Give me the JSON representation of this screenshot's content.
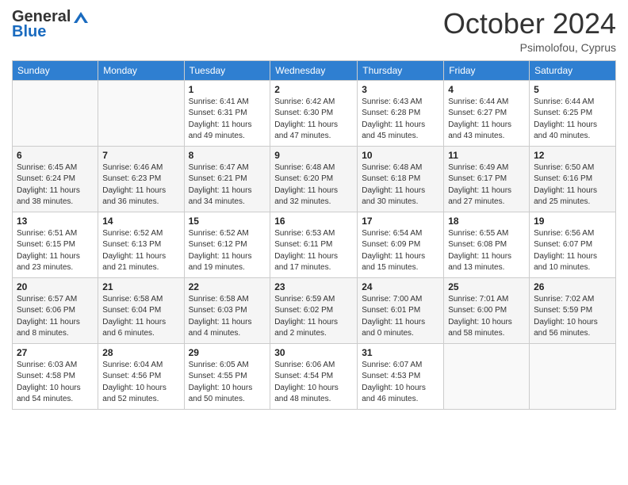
{
  "logo": {
    "general": "General",
    "blue": "Blue"
  },
  "header": {
    "month": "October 2024",
    "location": "Psimolofou, Cyprus"
  },
  "days_of_week": [
    "Sunday",
    "Monday",
    "Tuesday",
    "Wednesday",
    "Thursday",
    "Friday",
    "Saturday"
  ],
  "weeks": [
    [
      {
        "day": "",
        "info": ""
      },
      {
        "day": "",
        "info": ""
      },
      {
        "day": "1",
        "info": "Sunrise: 6:41 AM\nSunset: 6:31 PM\nDaylight: 11 hours and 49 minutes."
      },
      {
        "day": "2",
        "info": "Sunrise: 6:42 AM\nSunset: 6:30 PM\nDaylight: 11 hours and 47 minutes."
      },
      {
        "day": "3",
        "info": "Sunrise: 6:43 AM\nSunset: 6:28 PM\nDaylight: 11 hours and 45 minutes."
      },
      {
        "day": "4",
        "info": "Sunrise: 6:44 AM\nSunset: 6:27 PM\nDaylight: 11 hours and 43 minutes."
      },
      {
        "day": "5",
        "info": "Sunrise: 6:44 AM\nSunset: 6:25 PM\nDaylight: 11 hours and 40 minutes."
      }
    ],
    [
      {
        "day": "6",
        "info": "Sunrise: 6:45 AM\nSunset: 6:24 PM\nDaylight: 11 hours and 38 minutes."
      },
      {
        "day": "7",
        "info": "Sunrise: 6:46 AM\nSunset: 6:23 PM\nDaylight: 11 hours and 36 minutes."
      },
      {
        "day": "8",
        "info": "Sunrise: 6:47 AM\nSunset: 6:21 PM\nDaylight: 11 hours and 34 minutes."
      },
      {
        "day": "9",
        "info": "Sunrise: 6:48 AM\nSunset: 6:20 PM\nDaylight: 11 hours and 32 minutes."
      },
      {
        "day": "10",
        "info": "Sunrise: 6:48 AM\nSunset: 6:18 PM\nDaylight: 11 hours and 30 minutes."
      },
      {
        "day": "11",
        "info": "Sunrise: 6:49 AM\nSunset: 6:17 PM\nDaylight: 11 hours and 27 minutes."
      },
      {
        "day": "12",
        "info": "Sunrise: 6:50 AM\nSunset: 6:16 PM\nDaylight: 11 hours and 25 minutes."
      }
    ],
    [
      {
        "day": "13",
        "info": "Sunrise: 6:51 AM\nSunset: 6:15 PM\nDaylight: 11 hours and 23 minutes."
      },
      {
        "day": "14",
        "info": "Sunrise: 6:52 AM\nSunset: 6:13 PM\nDaylight: 11 hours and 21 minutes."
      },
      {
        "day": "15",
        "info": "Sunrise: 6:52 AM\nSunset: 6:12 PM\nDaylight: 11 hours and 19 minutes."
      },
      {
        "day": "16",
        "info": "Sunrise: 6:53 AM\nSunset: 6:11 PM\nDaylight: 11 hours and 17 minutes."
      },
      {
        "day": "17",
        "info": "Sunrise: 6:54 AM\nSunset: 6:09 PM\nDaylight: 11 hours and 15 minutes."
      },
      {
        "day": "18",
        "info": "Sunrise: 6:55 AM\nSunset: 6:08 PM\nDaylight: 11 hours and 13 minutes."
      },
      {
        "day": "19",
        "info": "Sunrise: 6:56 AM\nSunset: 6:07 PM\nDaylight: 11 hours and 10 minutes."
      }
    ],
    [
      {
        "day": "20",
        "info": "Sunrise: 6:57 AM\nSunset: 6:06 PM\nDaylight: 11 hours and 8 minutes."
      },
      {
        "day": "21",
        "info": "Sunrise: 6:58 AM\nSunset: 6:04 PM\nDaylight: 11 hours and 6 minutes."
      },
      {
        "day": "22",
        "info": "Sunrise: 6:58 AM\nSunset: 6:03 PM\nDaylight: 11 hours and 4 minutes."
      },
      {
        "day": "23",
        "info": "Sunrise: 6:59 AM\nSunset: 6:02 PM\nDaylight: 11 hours and 2 minutes."
      },
      {
        "day": "24",
        "info": "Sunrise: 7:00 AM\nSunset: 6:01 PM\nDaylight: 11 hours and 0 minutes."
      },
      {
        "day": "25",
        "info": "Sunrise: 7:01 AM\nSunset: 6:00 PM\nDaylight: 10 hours and 58 minutes."
      },
      {
        "day": "26",
        "info": "Sunrise: 7:02 AM\nSunset: 5:59 PM\nDaylight: 10 hours and 56 minutes."
      }
    ],
    [
      {
        "day": "27",
        "info": "Sunrise: 6:03 AM\nSunset: 4:58 PM\nDaylight: 10 hours and 54 minutes."
      },
      {
        "day": "28",
        "info": "Sunrise: 6:04 AM\nSunset: 4:56 PM\nDaylight: 10 hours and 52 minutes."
      },
      {
        "day": "29",
        "info": "Sunrise: 6:05 AM\nSunset: 4:55 PM\nDaylight: 10 hours and 50 minutes."
      },
      {
        "day": "30",
        "info": "Sunrise: 6:06 AM\nSunset: 4:54 PM\nDaylight: 10 hours and 48 minutes."
      },
      {
        "day": "31",
        "info": "Sunrise: 6:07 AM\nSunset: 4:53 PM\nDaylight: 10 hours and 46 minutes."
      },
      {
        "day": "",
        "info": ""
      },
      {
        "day": "",
        "info": ""
      }
    ]
  ]
}
